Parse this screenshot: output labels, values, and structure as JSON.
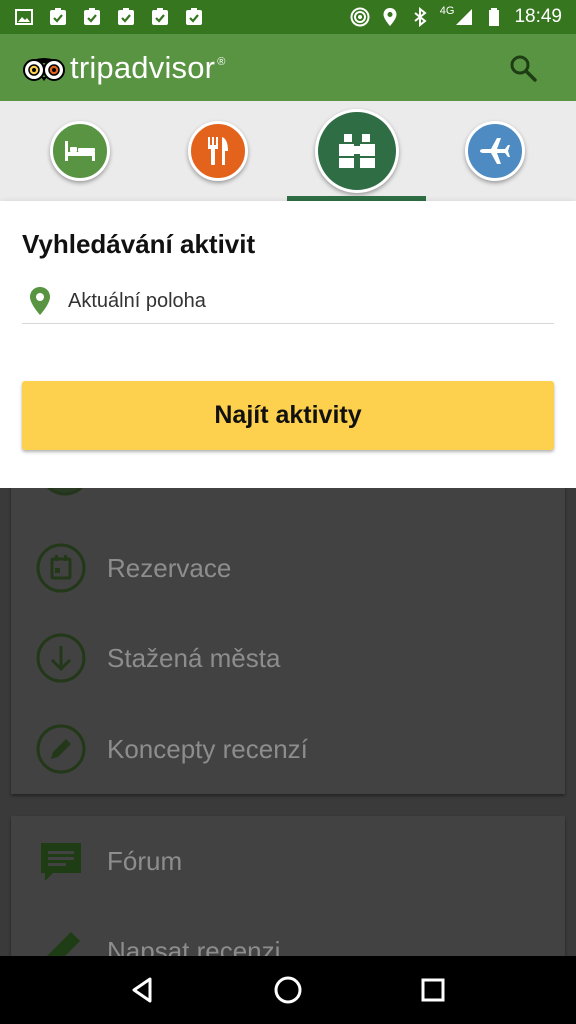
{
  "status_bar": {
    "time": "18:49",
    "network": "4G",
    "left_icons": [
      "image-icon",
      "checklist-icon",
      "checklist-icon",
      "checklist-icon",
      "checklist-icon",
      "checklist-icon"
    ],
    "right_icons": [
      "hotspot-icon",
      "location-icon",
      "bluetooth-icon",
      "signal-icon",
      "battery-icon"
    ]
  },
  "app_bar": {
    "logo_text": "tripadvisor",
    "logo_mark": "®",
    "search_icon": "search-icon"
  },
  "categories": [
    {
      "name": "hotels",
      "icon": "bed-icon",
      "color": "#589442",
      "selected": false
    },
    {
      "name": "restaurants",
      "icon": "fork-knife-icon",
      "color": "#e3631c",
      "selected": false
    },
    {
      "name": "things-to-do",
      "icon": "binoculars-icon",
      "color": "#2f6e45",
      "selected": true
    },
    {
      "name": "flights",
      "icon": "airplane-icon",
      "color": "#4f8bc3",
      "selected": false
    }
  ],
  "panel": {
    "title": "Vyhledávání aktivit",
    "location_value": "Aktuální poloha",
    "find_button": "Najít aktivity"
  },
  "menu_card1": [
    {
      "label": "Rezervace",
      "icon": "calendar-icon"
    },
    {
      "label": "Stažená města",
      "icon": "download-icon"
    },
    {
      "label": "Koncepty recenzí",
      "icon": "pencil-circle-icon"
    }
  ],
  "menu_card2": [
    {
      "label": "Fórum",
      "icon": "forum-icon"
    },
    {
      "label": "Napsat recenzi",
      "icon": "pencil-icon"
    }
  ],
  "nav_bar": [
    "back-icon",
    "home-icon",
    "recents-icon"
  ],
  "colors": {
    "status_bar": "#36761f",
    "app_bar": "#589442",
    "button": "#fdd14d",
    "indicator": "#2f6e45"
  }
}
